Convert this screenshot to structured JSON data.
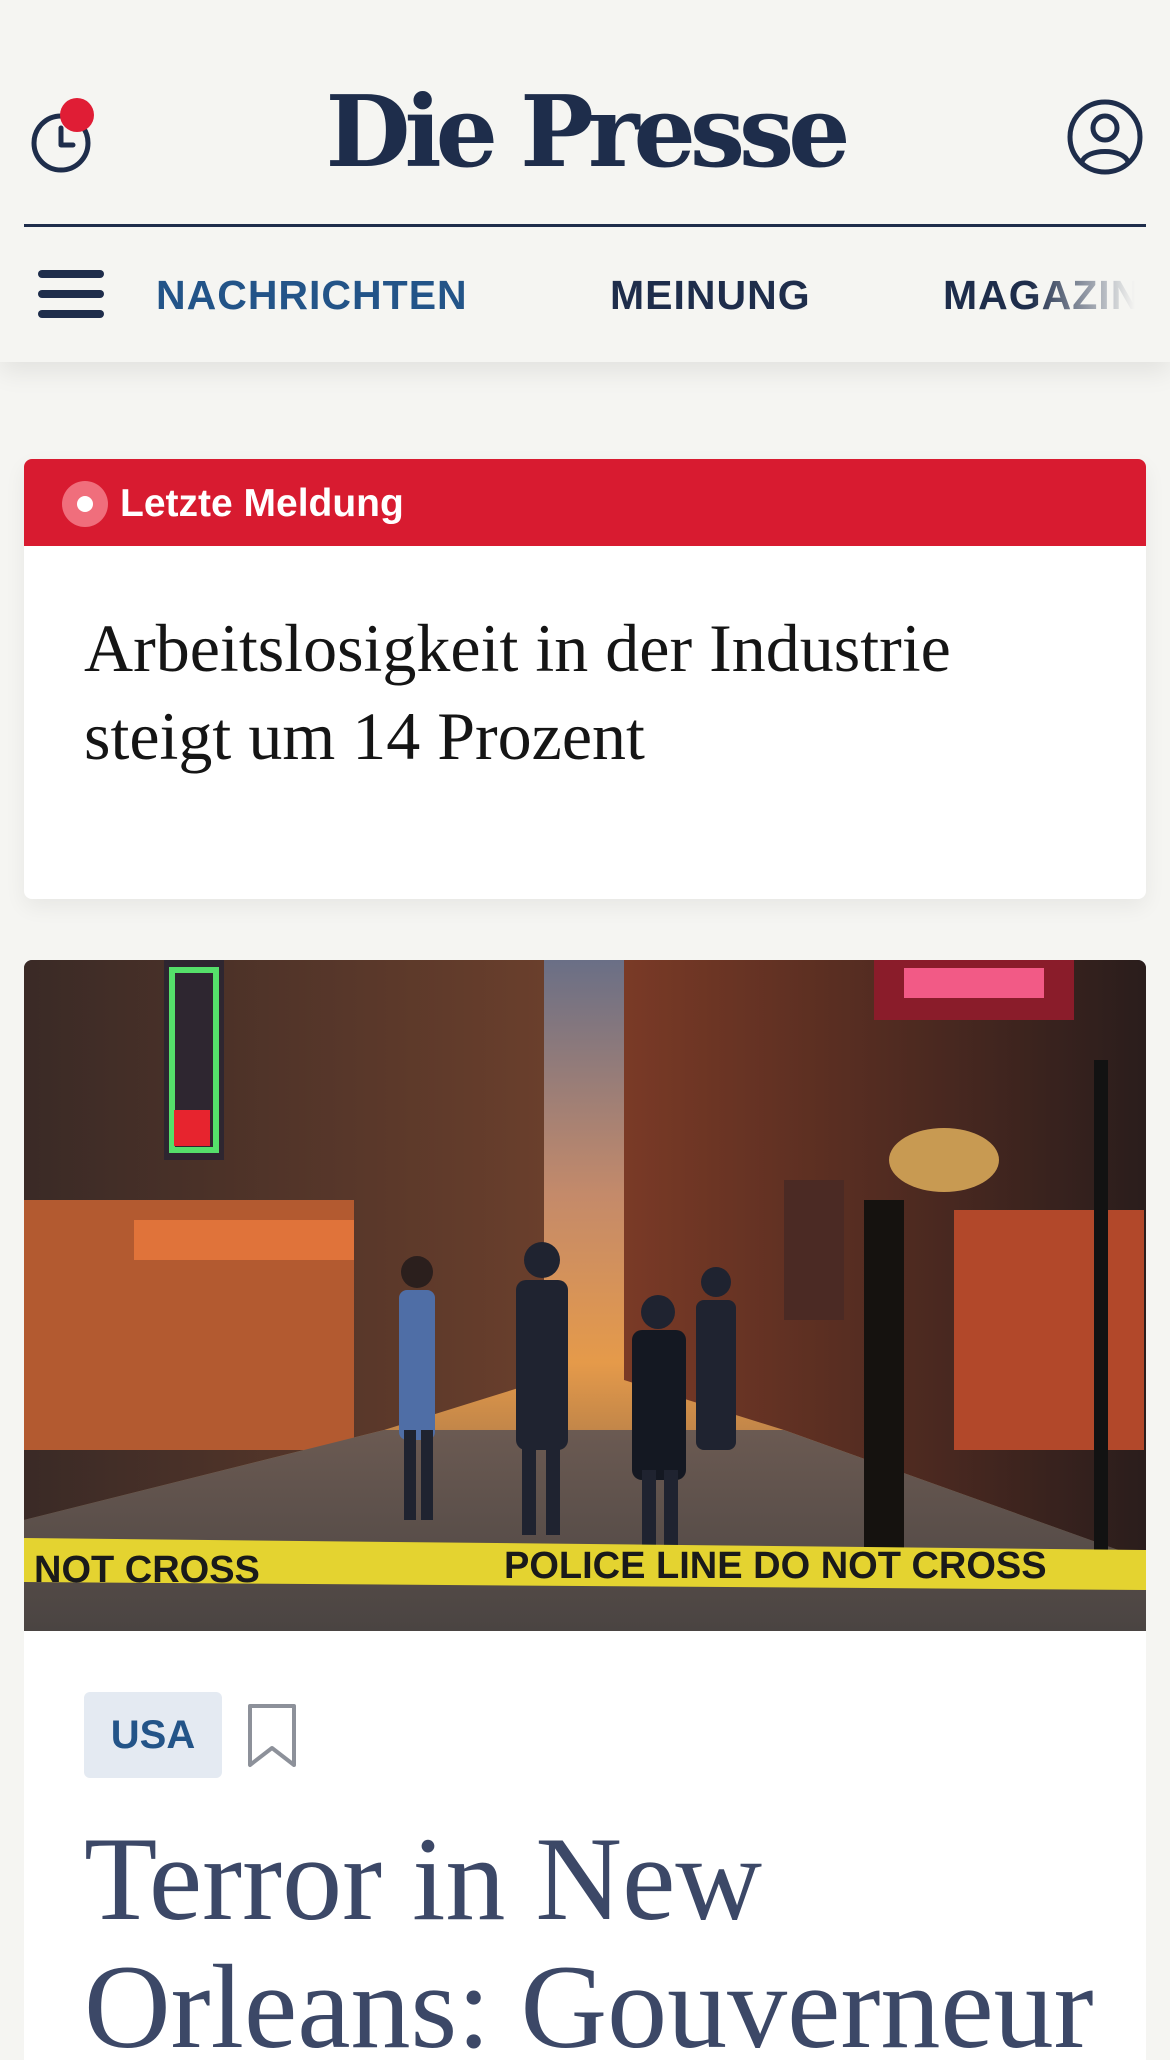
{
  "header": {
    "logo": "Die Presse",
    "history_icon": "clock-history-icon",
    "history_badge_color": "#e01d35",
    "account_icon": "user-account-icon",
    "menu_icon": "hamburger-menu-icon",
    "nav": [
      {
        "label": "NACHRICHTEN",
        "active": true
      },
      {
        "label": "MEINUNG",
        "active": false
      },
      {
        "label": "MAGAZIN",
        "active": false
      }
    ]
  },
  "breaking": {
    "label": "Letzte Meldung",
    "headline": "Arbeitslosigkeit in der Industrie steigt um 14 Prozent",
    "color": "#d81b30"
  },
  "article": {
    "image_description": "Police officers walking on Bourbon Street behind police tape at dawn",
    "tag": "USA",
    "bookmark_icon": "bookmark-icon",
    "headline": "Terror in New Orleans: Gouverneur"
  },
  "colors": {
    "brand_navy": "#1e2d4b",
    "link_blue": "#235488",
    "background": "#f5f5f2"
  }
}
